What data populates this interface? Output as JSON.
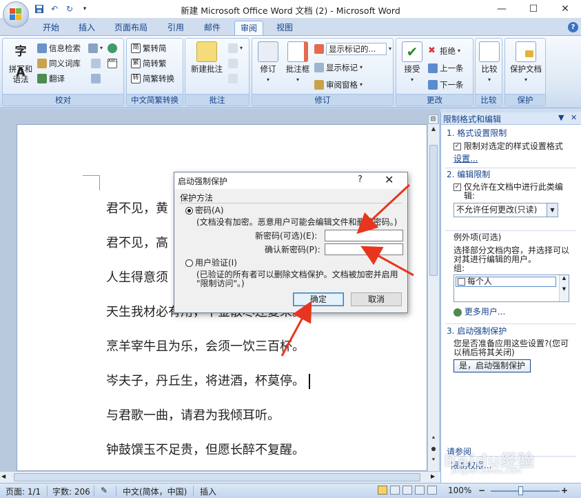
{
  "window": {
    "title": "新建 Microsoft Office Word 文档 (2) - Microsoft Word",
    "controls": {
      "minimize": "—",
      "maximize": "☐",
      "close": "✕"
    }
  },
  "quick_access": [
    "save-icon",
    "undo-icon",
    "redo-icon",
    "customize-icon"
  ],
  "ribbon_tabs": [
    "开始",
    "插入",
    "页面布局",
    "引用",
    "邮件",
    "审阅",
    "视图"
  ],
  "active_tab": "审阅",
  "help_label": "?",
  "groups": {
    "proofing": {
      "label": "校对",
      "spelling": "拼写和\n语法",
      "spelling_top": "拼写和",
      "spelling_bottom": "语法",
      "research": "信息检索",
      "thesaurus": "同义词库",
      "translate": "翻译"
    },
    "chinese": {
      "label": "中文简繁转换",
      "to_traditional": "繁转简",
      "to_simplified": "简转繁",
      "convert": "简繁转换"
    },
    "comments": {
      "label": "批注",
      "new_comment": "新建批注"
    },
    "tracking": {
      "label": "修订",
      "track_changes": "修订",
      "balloons": "批注框",
      "display_markup": "显示标记的...",
      "show_markup": "显示标记",
      "reviewing_pane": "审阅窗格"
    },
    "changes": {
      "label": "更改",
      "accept": "接受",
      "reject": "拒绝",
      "previous": "上一条",
      "next": "下一条"
    },
    "compare": {
      "label": "比较",
      "compare": "比较"
    },
    "protect": {
      "label": "保护",
      "protect_document": "保护文档"
    }
  },
  "document_lines": [
    "君不见，黄",
    "君不见，高",
    "人生得意须",
    "天生我材必有用，千金散尽还复来。",
    "烹羊宰牛且为乐，会须一饮三百杯。",
    "岑夫子，丹丘生，将进酒，杯莫停。",
    "与君歌一曲，请君为我倾耳听。",
    "钟鼓馔玉不足贵，但愿长醉不复醒。"
  ],
  "task_pane": {
    "title": "限制格式和编辑",
    "section1": "1. 格式设置限制",
    "limit_formatting": "限制对选定的样式设置格式",
    "settings_link": "设置...",
    "section2": "2. 编辑限制",
    "allow_editing_line1": "仅允许在文档中进行此类编",
    "allow_editing_line2": "辑:",
    "editing_type": "不允许任何更改(只读)",
    "exceptions_title": "例外项(可选)",
    "exceptions_desc_line1": "选择部分文档内容，并选择可以",
    "exceptions_desc_line2": "对其进行编辑的用户。",
    "groups_label": "组:",
    "everyone": "每个人",
    "more_users": "更多用户...",
    "section3": "3. 启动强制保护",
    "apply_question_line1": "您是否准备应用这些设置?(您可",
    "apply_question_line2": "以稍后将其关闭)",
    "start_button": "是，启动强制保护",
    "bottom_link1": "请参阅",
    "bottom_link2": "限制权限..."
  },
  "dialog": {
    "title": "启动强制保护",
    "help": "?",
    "close": "✕",
    "group_label": "保护方法",
    "password_option": "密码(A)",
    "password_desc": "(文档没有加密。恶意用户可能会编辑文件和删除密码。)",
    "new_password_label": "新密码(可选)(E):",
    "confirm_password_label": "确认新密码(P):",
    "new_password_value": "",
    "confirm_password_value": "",
    "user_auth_option": "用户验证(I)",
    "user_auth_desc_line1": "(已验证的所有者可以删除文档保护。文档被加密并启用",
    "user_auth_desc_line2": "\"限制访问\"。)",
    "ok": "确定",
    "cancel": "取消"
  },
  "status_bar": {
    "page": "页面: 1/1",
    "words": "字数: 206",
    "language": "中文(简体，中国)",
    "mode": "插入",
    "zoom": "100%",
    "zoom_out": "−",
    "zoom_in": "+"
  },
  "watermark": {
    "text": "Baidu经验",
    "sub": "jingyan.baidu.com"
  },
  "colors": {
    "accent": "#15428b",
    "arrow": "#e8351f",
    "ribbon": "#dde8f5"
  }
}
